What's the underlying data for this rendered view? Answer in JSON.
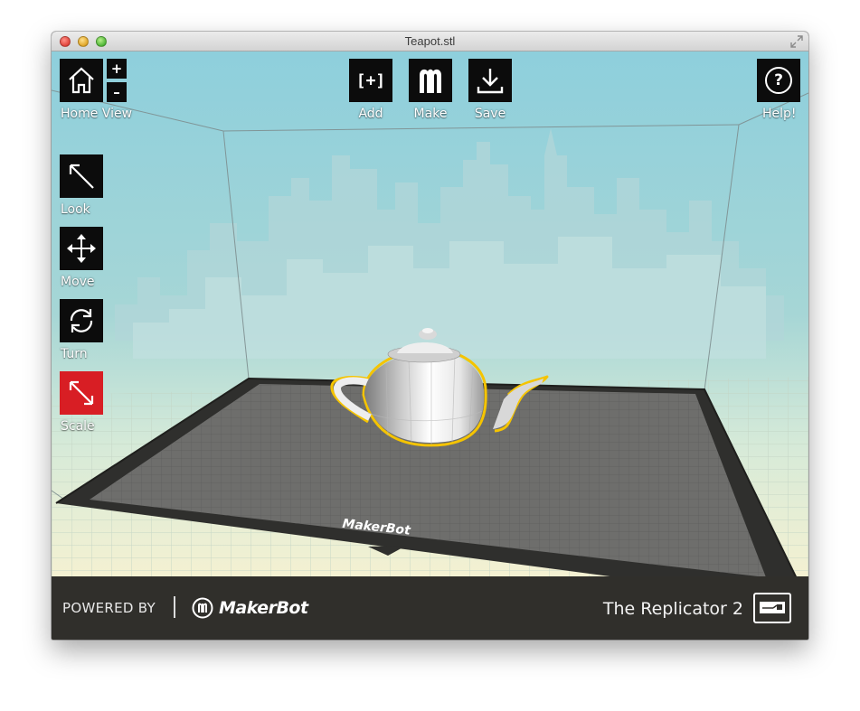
{
  "window": {
    "title": "Teapot.stl"
  },
  "toolbar": {
    "home_label": "Home View",
    "zoom_in": "+",
    "zoom_out": "–",
    "add_label": "Add",
    "add_icon_text": "[+]",
    "make_label": "Make",
    "save_label": "Save",
    "help_label": "Help!",
    "help_icon_text": "?"
  },
  "tools": {
    "look_label": "Look",
    "move_label": "Move",
    "turn_label": "Turn",
    "scale_label": "Scale",
    "active_tool": "scale"
  },
  "scene": {
    "object": "teapot",
    "platform_brand": "MakerBot"
  },
  "footer": {
    "powered_by": "POWERED BY",
    "brand": "MakerBot",
    "printer": "The Replicator 2"
  },
  "colors": {
    "accent_active_tool": "#d81e24",
    "selection_outline": "#f5c400",
    "toolbar_button": "#0c0c0c",
    "footer_bg": "#302f2b"
  }
}
